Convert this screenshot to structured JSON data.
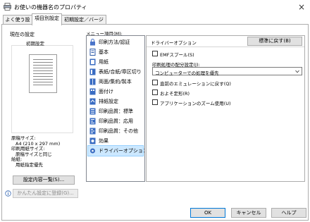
{
  "window": {
    "title": "お使いの機器名のプロパティ",
    "close_label": "×"
  },
  "tabs": [
    {
      "label": "よく使う設定"
    },
    {
      "label": "項目別設定"
    },
    {
      "label": "初期設定／バージョン"
    }
  ],
  "left": {
    "current_settings_label": "現在の設定",
    "initial_setting": "初期設定",
    "summary": {
      "paper_size_label": "原稿サイズ:",
      "paper_size_value": "A4 (210 x 297 mm)",
      "print_size_label": "印刷用紙サイズ:",
      "print_size_value": "原稿サイズと同じ",
      "tray_label": "給紙:",
      "tray_value": "用紙指定優先"
    },
    "settings_list_button": "設定内容一覧(S)...",
    "register_button": "かんたん設定に登録(G)..."
  },
  "menu": {
    "label": "メニュー項目(M):",
    "items": [
      {
        "label": "印刷方法/認証",
        "icon": "lock-icon"
      },
      {
        "label": "基本",
        "icon": "document-icon"
      },
      {
        "label": "用紙",
        "icon": "paper-icon"
      },
      {
        "label": "表紙/合紙/章区切り",
        "icon": "cover-icon"
      },
      {
        "label": "両面/集約/製本",
        "icon": "duplex-icon"
      },
      {
        "label": "面付け",
        "icon": "imposition-icon"
      },
      {
        "label": "排紙設定",
        "icon": "output-icon"
      },
      {
        "label": "印刷品質：標準",
        "icon": "quality-icon"
      },
      {
        "label": "印刷品質：応用",
        "icon": "quality-advanced-icon"
      },
      {
        "label": "印刷品質：その他",
        "icon": "quality-other-icon"
      },
      {
        "label": "効果",
        "icon": "effect-icon"
      },
      {
        "label": "ドライバーオプション",
        "icon": "gear-icon"
      }
    ],
    "selected_index": 11
  },
  "detail": {
    "header_title": "ドライバーオプション",
    "reset_button": "標準に戻す(B)",
    "emf_spool_label": "EMFスプール(S)",
    "emf_spool_checked": false,
    "distribution_label": "印刷処理の配分設定(J):",
    "distribution_value": "コンピューターでの処理を優先",
    "emulation_label": "直前のエミュレーションに戻す(Q)",
    "emulation_checked": false,
    "font_shape_label": "およそ定形(R)",
    "font_shape_checked": false,
    "app_zoom_label": "アプリケーションのズーム使用(U)",
    "app_zoom_checked": false
  },
  "footer": {
    "ok": "OK",
    "cancel": "キャンセル",
    "help": "ヘルプ"
  },
  "colors": {
    "selection": "#cce8ff",
    "button_face": "#e1e1e1",
    "border": "#adadad"
  }
}
